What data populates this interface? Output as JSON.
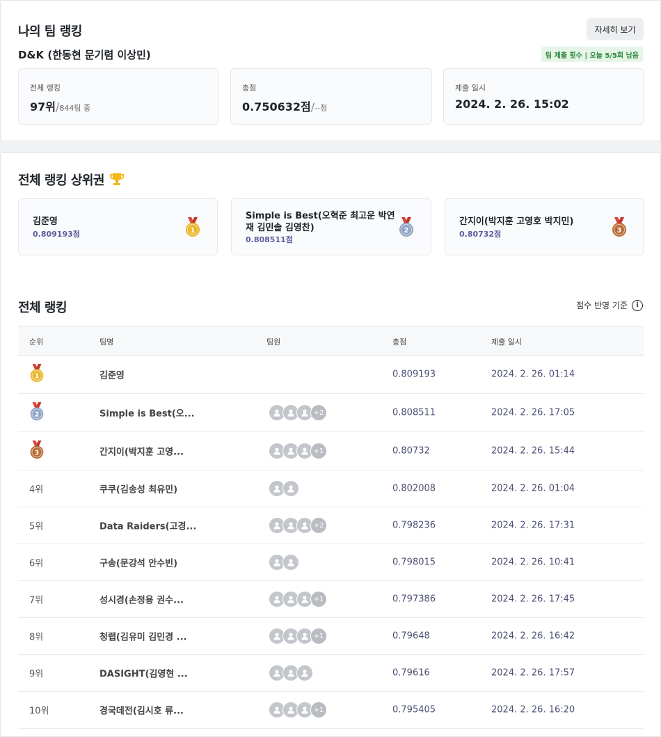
{
  "my_team": {
    "title": "나의 팀 랭킹",
    "detail_button": "자세히 보기",
    "team_name": "D&K (한동현 문기렴 이상민)",
    "quota": "팀 제출 횟수 | 오늘 5/5회 남음",
    "stats": [
      {
        "label": "전체 랭킹",
        "value": "97위",
        "sub": "844팀 중"
      },
      {
        "label": "총점",
        "value": "0.750632점",
        "sub": "--점"
      },
      {
        "label": "제출 일시",
        "value": "2024. 2. 26. 15:02"
      }
    ]
  },
  "top": {
    "title": "전체 랭킹 상위권",
    "trophy_icon": "trophy-icon",
    "cards": [
      {
        "name": "김준영",
        "score": "0.809193점",
        "medal": "1",
        "color": "#e9b52a"
      },
      {
        "name": "Simple is Best(오혁준 최고운 박연재 김민솔 김영찬)",
        "score": "0.808511점",
        "medal": "2",
        "color": "#8fa3c4"
      },
      {
        "name": "간지이(박지훈 고영호 박지민)",
        "score": "0.80732점",
        "medal": "3",
        "color": "#b86a35"
      }
    ]
  },
  "ranking": {
    "title": "전체 랭킹",
    "criteria_label": "점수 반영 기준",
    "columns": {
      "rank": "순위",
      "team": "팀명",
      "members": "팀원",
      "score": "총점",
      "date": "제출 일시"
    },
    "rows": [
      {
        "rank": "1",
        "team": "김준영",
        "members": 0,
        "more": "",
        "score": "0.809193",
        "date": "2024. 2. 26. 01:14"
      },
      {
        "rank": "2",
        "team": "Simple is Best(오...",
        "members": 3,
        "more": "+2",
        "score": "0.808511",
        "date": "2024. 2. 26. 17:05"
      },
      {
        "rank": "3",
        "team": "간지이(박지훈 고영...",
        "members": 3,
        "more": "+1",
        "score": "0.80732",
        "date": "2024. 2. 26. 15:44"
      },
      {
        "rank": "4위",
        "team": "쿠쿠(김송성 최유민)",
        "members": 2,
        "more": "",
        "score": "0.802008",
        "date": "2024. 2. 26. 01:04"
      },
      {
        "rank": "5위",
        "team": "Data Raiders(고경...",
        "members": 3,
        "more": "+2",
        "score": "0.798236",
        "date": "2024. 2. 26. 17:31"
      },
      {
        "rank": "6위",
        "team": "구송(문강석 안수빈)",
        "members": 2,
        "more": "",
        "score": "0.798015",
        "date": "2024. 2. 26. 10:41"
      },
      {
        "rank": "7위",
        "team": "성시경(손정용 권수...",
        "members": 3,
        "more": "+1",
        "score": "0.797386",
        "date": "2024. 2. 26. 17:45"
      },
      {
        "rank": "8위",
        "team": "청랩(김유미 김민경 ...",
        "members": 3,
        "more": "+1",
        "score": "0.79648",
        "date": "2024. 2. 26. 16:42"
      },
      {
        "rank": "9위",
        "team": "DASIGHT(김영현 ...",
        "members": 3,
        "more": "",
        "score": "0.79616",
        "date": "2024. 2. 26. 17:57"
      },
      {
        "rank": "10위",
        "team": "경국데전(김시호 류...",
        "members": 3,
        "more": "+1",
        "score": "0.795405",
        "date": "2024. 2. 26. 16:20"
      }
    ]
  }
}
